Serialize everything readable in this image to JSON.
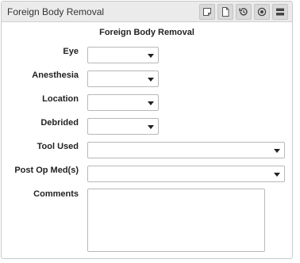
{
  "panel": {
    "title": "Foreign Body Removal",
    "toolbar": [
      "note-icon",
      "document-icon",
      "history-icon",
      "target-icon",
      "collapse-icon"
    ]
  },
  "form": {
    "title": "Foreign Body Removal",
    "fields": {
      "eye": {
        "label": "Eye",
        "value": ""
      },
      "anesthesia": {
        "label": "Anesthesia",
        "value": ""
      },
      "location": {
        "label": "Location",
        "value": ""
      },
      "debrided": {
        "label": "Debrided",
        "value": ""
      },
      "tool_used": {
        "label": "Tool Used",
        "value": ""
      },
      "post_op_meds": {
        "label": "Post Op Med(s)",
        "value": ""
      },
      "comments": {
        "label": "Comments",
        "value": ""
      }
    }
  }
}
